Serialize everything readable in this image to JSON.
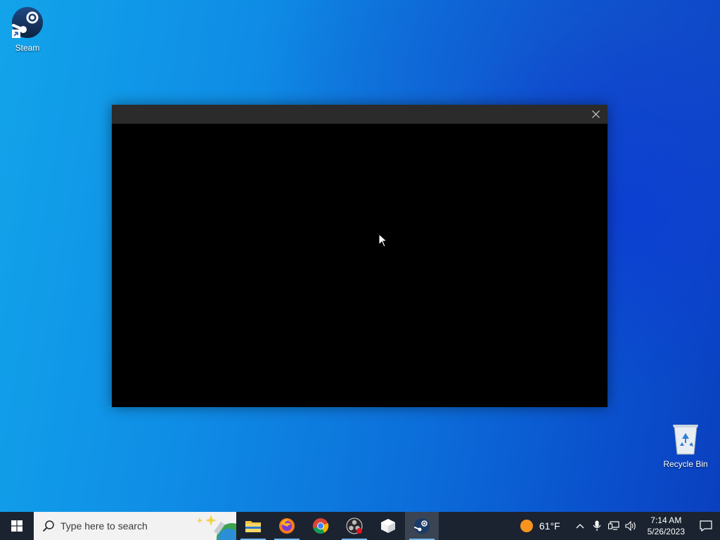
{
  "desktop": {
    "icons": [
      {
        "label": "Steam"
      },
      {
        "label": "Recycle Bin"
      }
    ]
  },
  "window": {
    "close_glyph": "✕"
  },
  "taskbar": {
    "search": {
      "placeholder": "Type here to search"
    },
    "apps": [
      {
        "name": "File Explorer",
        "icon": "folder-icon"
      },
      {
        "name": "Firefox",
        "icon": "firefox-icon"
      },
      {
        "name": "Chrome",
        "icon": "chrome-icon"
      },
      {
        "name": "OBS",
        "icon": "obs-icon"
      },
      {
        "name": "Package",
        "icon": "box-icon"
      },
      {
        "name": "Steam",
        "icon": "steam-icon",
        "active": true
      }
    ],
    "weather": {
      "temp": "61°F",
      "icon": "sun-icon"
    },
    "clock": {
      "time": "7:14 AM",
      "date": "5/26/2023"
    }
  },
  "colors": {
    "taskbar": "#1b2330",
    "window_title": "#2b2b2b",
    "accent": "#76b9ed"
  }
}
